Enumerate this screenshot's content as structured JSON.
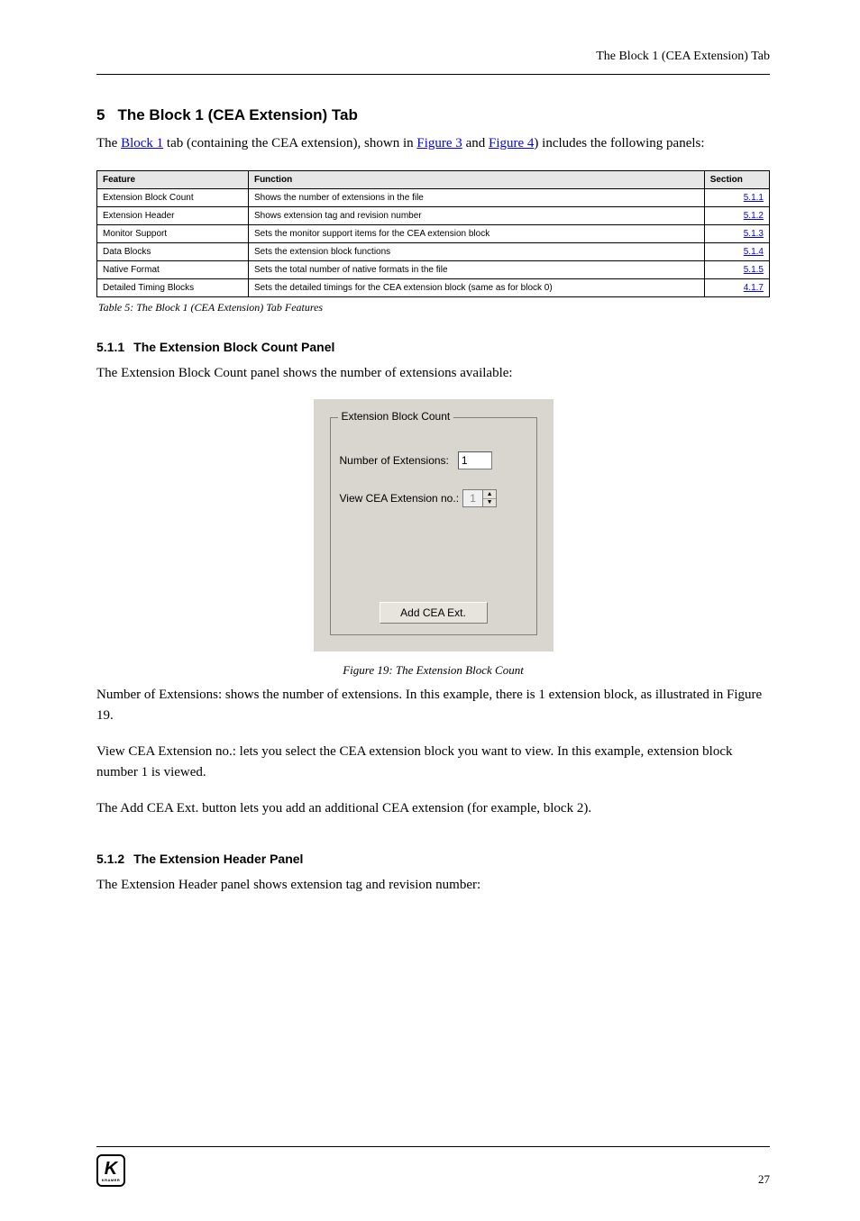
{
  "header_right": "The Block 1 (CEA Extension) Tab",
  "section": {
    "number": "5",
    "title": "The Block 1 (CEA Extension) Tab"
  },
  "intro_1_before_link": "The ",
  "intro_1_link": "Block 1",
  "intro_1_after_link": " tab (containing the CEA extension), shown in ",
  "intro_1_fig3": "Figure 3",
  "intro_1_and": " and",
  "intro_1_fig4": "Figure 4",
  "intro_1_tail": ") includes the following panels:",
  "table": {
    "headers": [
      "Feature",
      "Function",
      "Section"
    ],
    "rows": [
      {
        "feature": "Extension Block Count",
        "function": "Shows the number of extensions in the file",
        "section": "5.1.1"
      },
      {
        "feature": "Extension Header",
        "function": "Shows extension tag and revision number",
        "section": "5.1.2"
      },
      {
        "feature": "Monitor Support",
        "function": "Sets the monitor support items for the CEA extension block",
        "section": "5.1.3"
      },
      {
        "feature": "Data Blocks",
        "function": "Sets the extension block functions",
        "section": "5.1.4"
      },
      {
        "feature": "Native Format",
        "function": "Sets the total number of native formats in the file",
        "section": "5.1.5"
      },
      {
        "feature": "Detailed Timing Blocks",
        "function": "Sets the detailed timings for the CEA extension block (same as for block 0)",
        "section": "4.1.7"
      }
    ]
  },
  "table_caption": "Table 5: The Block 1 (CEA Extension) Tab Features",
  "sub1": {
    "number": "5.1.1",
    "title": "The Extension Block Count Panel"
  },
  "sub1_body": "The Extension Block Count panel shows the number of extensions available:",
  "panel": {
    "group_title": "Extension Block Count",
    "num_ext_label": "Number of Extensions:",
    "num_ext_value": "1",
    "view_label": "View CEA Extension no.:",
    "view_value": "1",
    "add_btn": "Add CEA Ext."
  },
  "fig_caption": "Figure 19: The Extension Block Count",
  "sub1_para2": "Number of Extensions: shows the number of extensions. In this example, there is 1 extension block, as illustrated in Figure 19.",
  "sub1_para3": "View CEA Extension no.: lets you select the CEA extension block you want to view. In this example, extension block number 1 is viewed.",
  "sub1_para4_span1": "The ",
  "sub1_para4_btn": "Add CEA Ext.",
  "sub1_para4_span2": " button lets you add an additional CEA extension (for example, block 2).",
  "sub2": {
    "number": "5.1.2",
    "title": "The Extension Header Panel"
  },
  "sub2_body": "The Extension Header panel shows extension tag and revision number:",
  "footer": {
    "logo_k": "K",
    "logo_text": "KRAMER",
    "page": "27"
  }
}
